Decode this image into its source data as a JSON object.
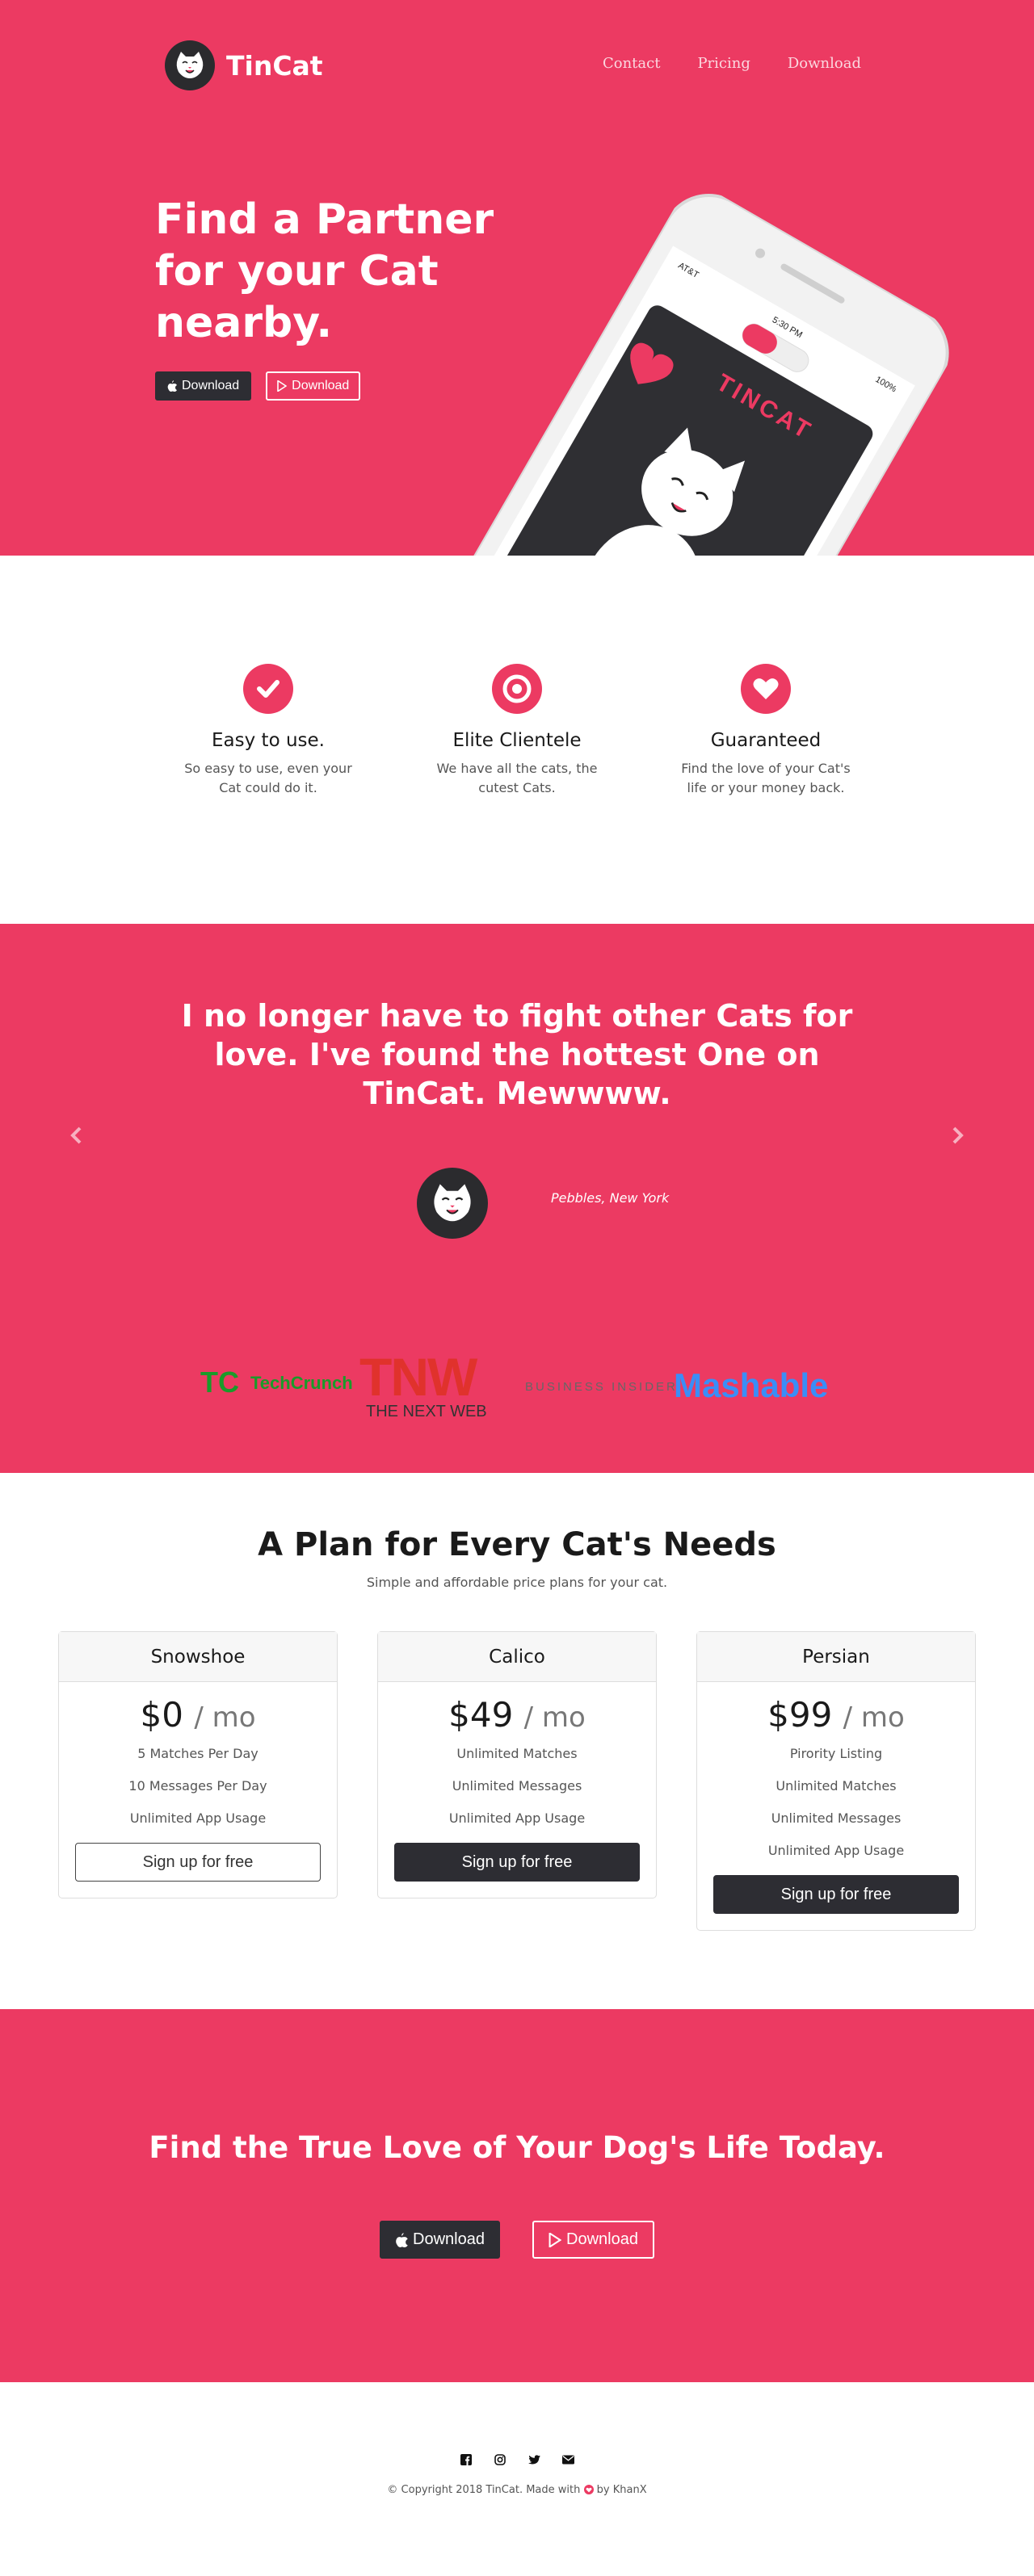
{
  "brand": {
    "name": "TinCat"
  },
  "nav": {
    "links": [
      "Contact",
      "Pricing",
      "Download"
    ]
  },
  "hero": {
    "title": "Find a Partner for your Cat nearby.",
    "btn_apple": "Download",
    "btn_play": "Download",
    "phone": {
      "carrier": "AT&T",
      "time": "5:30 PM",
      "battery": "100%",
      "app_name": "TINCAT"
    }
  },
  "features": [
    {
      "title": "Easy to use.",
      "text": "So easy to use, even your Cat could do it.",
      "icon": "check-icon"
    },
    {
      "title": "Elite Clientele",
      "text": "We have all the cats, the cutest Cats.",
      "icon": "bullseye-icon"
    },
    {
      "title": "Guaranteed",
      "text": "Find the love of your Cat's life or your money back.",
      "icon": "heart-icon"
    }
  ],
  "testimonial": {
    "quote": "I no longer have to fight other Cats for love. I've found the hottest One on TinCat. Mewwww.",
    "author": "Pebbles, New York"
  },
  "press": {
    "techcrunch_tc": "TC",
    "techcrunch_name": "TechCrunch",
    "tnw_logo": "TNW",
    "tnw_name": "THE NEXT WEB",
    "business_insider": "BUSINESS INSIDER",
    "mashable": "Mashable"
  },
  "pricing": {
    "title": "A Plan for Every Cat's Needs",
    "subtitle": "Simple and affordable price plans for your cat.",
    "plans": [
      {
        "name": "Snowshoe",
        "price": "$0",
        "period": "/ mo",
        "features": [
          "5 Matches Per Day",
          "10 Messages Per Day",
          "Unlimited App Usage"
        ],
        "cta": "Sign up for free"
      },
      {
        "name": "Calico",
        "price": "$49",
        "period": "/ mo",
        "features": [
          "Unlimited Matches",
          "Unlimited Messages",
          "Unlimited App Usage"
        ],
        "cta": "Sign up for free"
      },
      {
        "name": "Persian",
        "price": "$99",
        "period": "/ mo",
        "features": [
          "Pirority Listing",
          "Unlimited Matches",
          "Unlimited Messages",
          "Unlimited App Usage"
        ],
        "cta": "Sign up for free"
      }
    ]
  },
  "cta": {
    "title": "Find the True Love of Your Dog's Life Today.",
    "btn_apple": "Download",
    "btn_play": "Download"
  },
  "footer": {
    "socials": [
      "facebook-icon",
      "instagram-icon",
      "twitter-icon",
      "envelope-icon"
    ],
    "copyright_pre": "© Copyright 2018 TinCat. Made with",
    "copyright_post": "by KhanX"
  },
  "colors": {
    "brand_pink": "#ec3a62",
    "dark": "#2d2d33"
  }
}
